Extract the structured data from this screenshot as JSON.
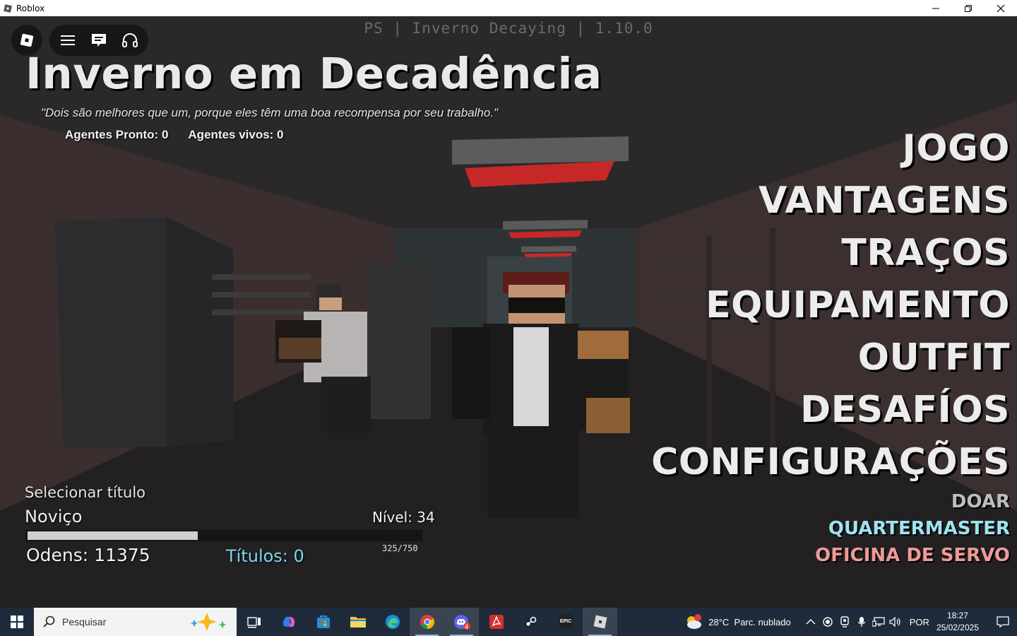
{
  "window": {
    "title": "Roblox"
  },
  "game": {
    "version_banner": "PS | Inverno Decaying | 1.10.0",
    "title": "Inverno em Decadência",
    "quote": "\"Dois são melhores que um, porque eles têm uma boa recompensa por seu trabalho.\"",
    "agents_ready": "Agentes Pronto: 0",
    "agents_alive": "Agentes vivos: 0"
  },
  "menu": {
    "items": [
      "JOGO",
      "VANTAGENS",
      "TRAÇOS",
      "EQUIPAMENTO",
      "OUTFIT",
      "DESAFÍOS",
      "CONFIGURAÇÕES"
    ],
    "donate": "DOAR",
    "quartermaster": "QUARTERMASTER",
    "workshop": "OFICINA DE SERVO"
  },
  "colors": {
    "donate": "#bdbdbd",
    "quartermaster": "#9fe3f0",
    "workshop": "#ef9a9a"
  },
  "player": {
    "select_title": "Selecionar título",
    "rank": "Noviço",
    "level": "Nível: 34",
    "xp_text": "325/750",
    "xp_fraction": 0.4333,
    "odens": "Odens: 11375",
    "titles": "Títulos: 0"
  },
  "taskbar": {
    "search_placeholder": "Pesquisar",
    "weather": "28°C  Parc. nublado",
    "weather_badge": "1",
    "language": "POR",
    "time": "18:27",
    "date": "25/02/2025",
    "discord_badge": "4",
    "apps": [
      "task-view",
      "copilot",
      "microsoft-store",
      "file-explorer",
      "edge",
      "chrome",
      "discord",
      "acrobat",
      "steam",
      "epic-games",
      "roblox"
    ]
  }
}
